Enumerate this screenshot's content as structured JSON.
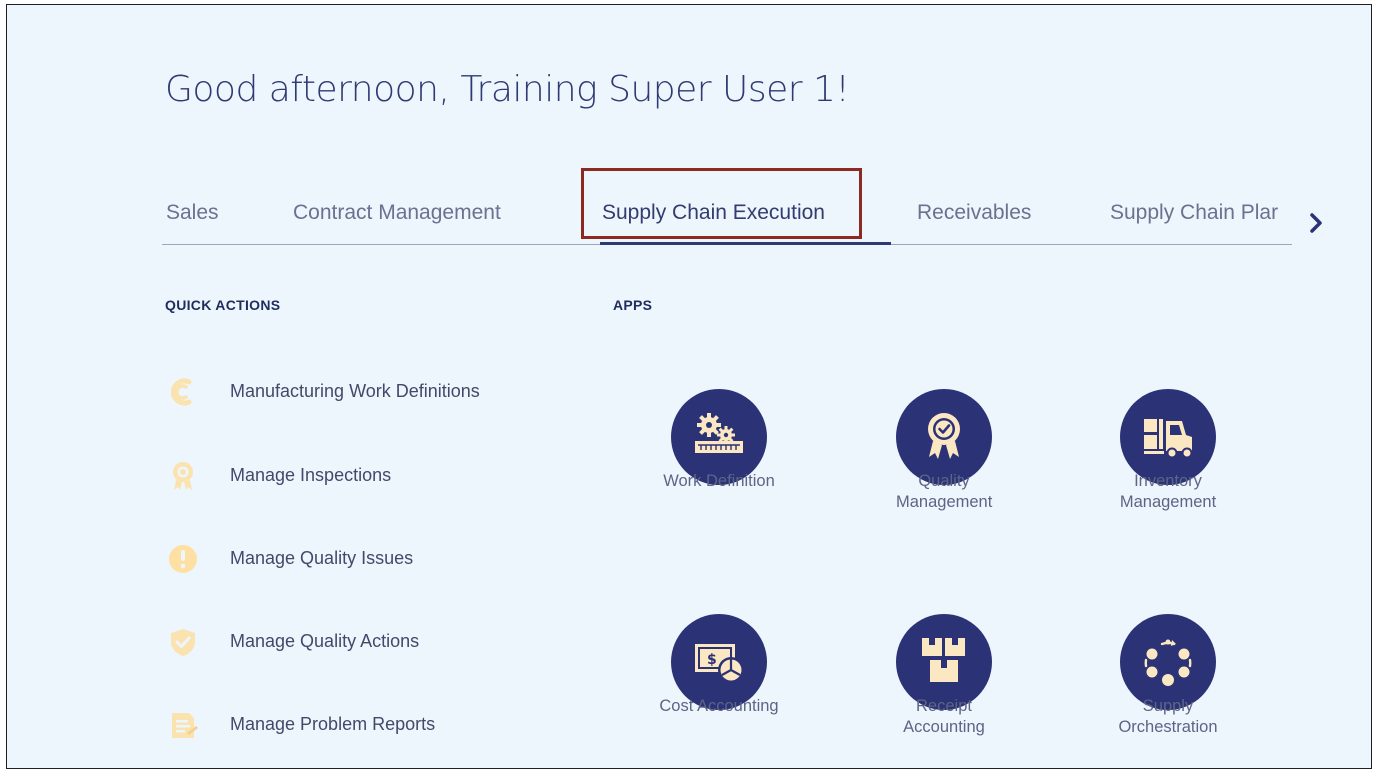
{
  "greeting": "Good afternoon, Training Super User 1!",
  "tabs": [
    {
      "label": "Sales"
    },
    {
      "label": "Contract Management"
    },
    {
      "label": "Supply Chain Execution",
      "active": true
    },
    {
      "label": "Receivables"
    },
    {
      "label": "Supply Chain Plar"
    }
  ],
  "quick_actions": {
    "title": "QUICK ACTIONS",
    "items": [
      {
        "label": "Manufacturing Work Definitions",
        "icon": "work-definitions-icon"
      },
      {
        "label": "Manage Inspections",
        "icon": "inspection-icon"
      },
      {
        "label": "Manage Quality Issues",
        "icon": "quality-issue-icon"
      },
      {
        "label": "Manage Quality Actions",
        "icon": "quality-action-icon"
      },
      {
        "label": "Manage Problem Reports",
        "icon": "problem-report-icon"
      }
    ]
  },
  "apps": {
    "title": "APPS",
    "items": [
      {
        "label": "Work Definition",
        "icon": "work-definition-icon"
      },
      {
        "label": "Quality Management",
        "icon": "quality-management-icon"
      },
      {
        "label": "Inventory Management",
        "icon": "inventory-management-icon"
      },
      {
        "label": "Cost Accounting",
        "icon": "cost-accounting-icon"
      },
      {
        "label": "Receipt Accounting",
        "icon": "receipt-accounting-icon"
      },
      {
        "label": "Supply Orchestration",
        "icon": "supply-orchestration-icon"
      }
    ]
  },
  "colors": {
    "background": "#edf5fd",
    "app_circle": "#2b3276",
    "icon_fill": "#fbe7c2",
    "highlight_border": "#8c2a22",
    "quick_action_icon": "#fde6b4"
  }
}
